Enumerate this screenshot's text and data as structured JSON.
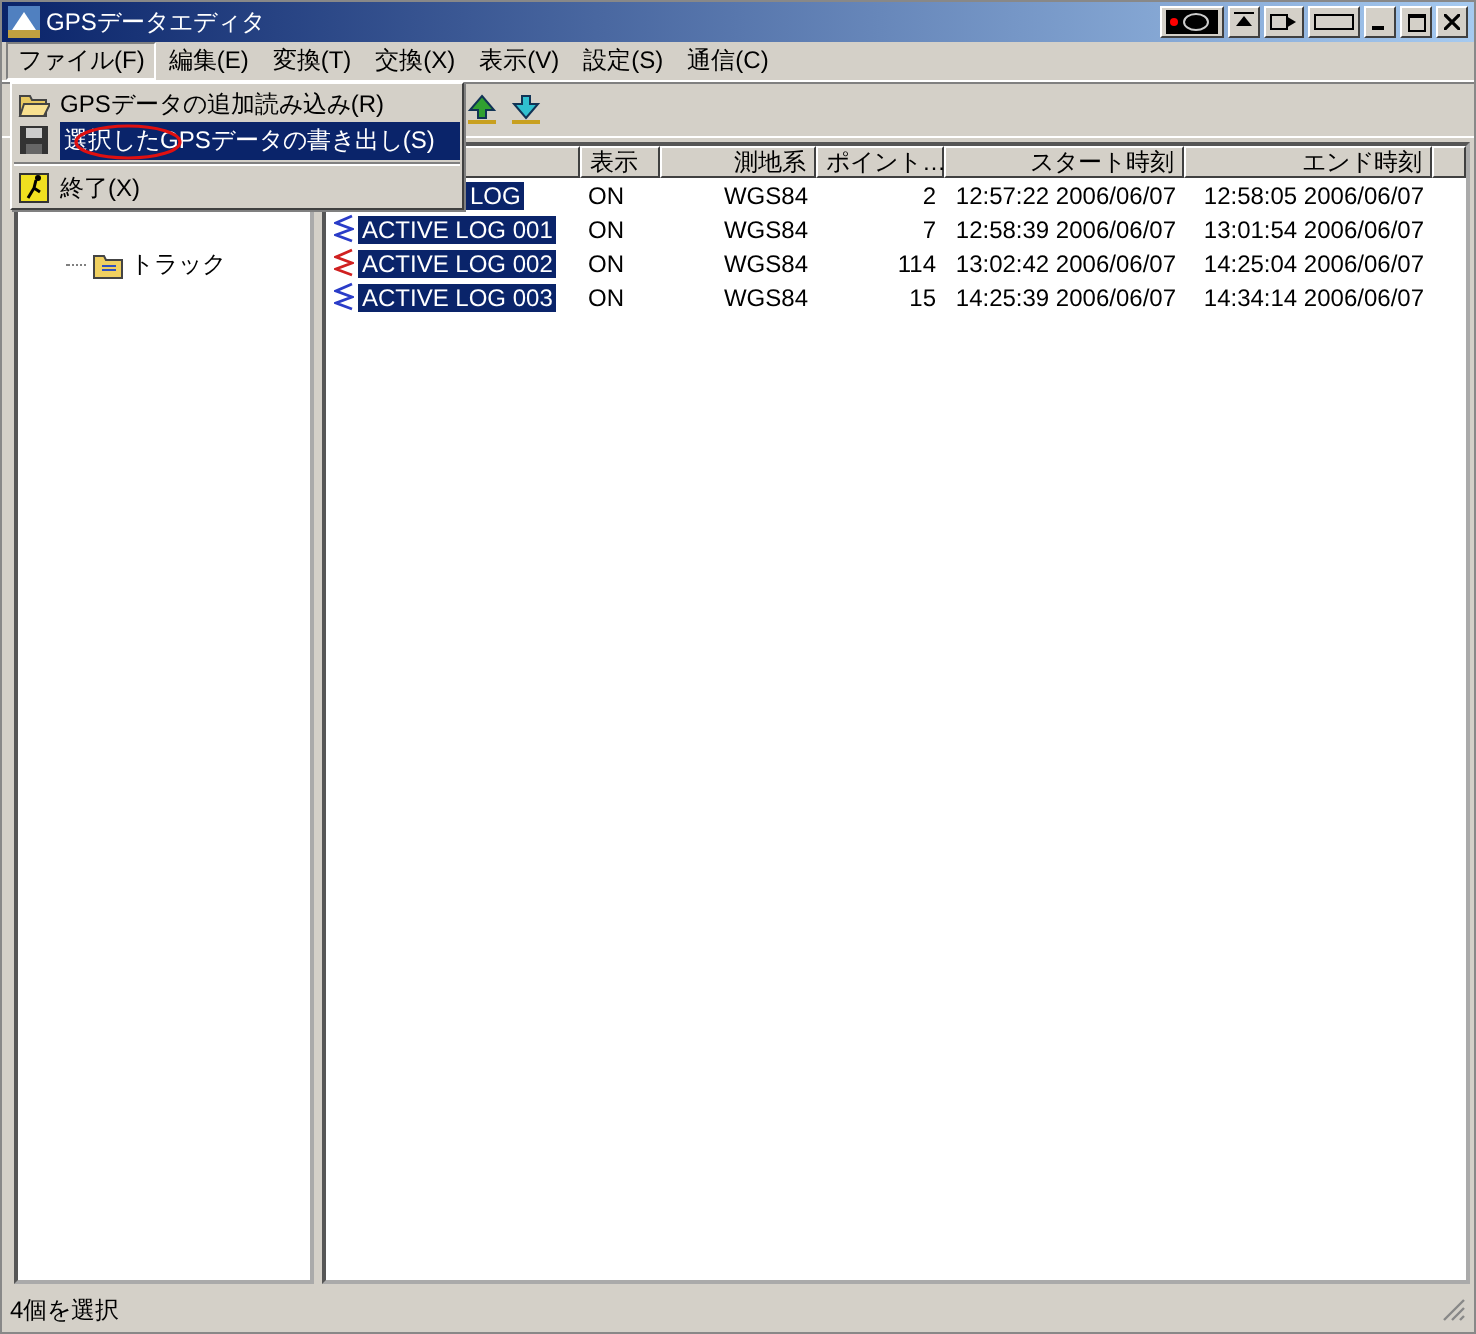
{
  "window": {
    "title": "GPSデータエディタ"
  },
  "menu_bar": [
    {
      "label": "ファイル(F)",
      "selected": true
    },
    {
      "label": "編集(E)",
      "selected": false
    },
    {
      "label": "変換(T)",
      "selected": false
    },
    {
      "label": "交換(X)",
      "selected": false
    },
    {
      "label": "表示(V)",
      "selected": false
    },
    {
      "label": "設定(S)",
      "selected": false
    },
    {
      "label": "通信(C)",
      "selected": false
    }
  ],
  "file_menu": [
    {
      "kind": "open",
      "label": "GPSデータの追加読み込み(R)",
      "selected": false,
      "separator_before": false
    },
    {
      "kind": "save",
      "label": "選択したGPSデータの書き出し(S)",
      "selected": true,
      "separator_before": false
    },
    {
      "kind": "exit",
      "label": "終了(X)",
      "selected": false,
      "separator_before": true
    }
  ],
  "tree": {
    "items": [
      {
        "label": "トラック"
      }
    ]
  },
  "table": {
    "columns": [
      "表示",
      "測地系",
      "ポイント…",
      "スタート時刻",
      "エンド時刻"
    ],
    "rows": [
      {
        "name": "LOG",
        "selected": true,
        "cells": [
          "ON",
          "WGS84",
          "2",
          "12:57:22 2006/06/07",
          "12:58:05 2006/06/07"
        ]
      },
      {
        "name": "ACTIVE LOG 001",
        "color": "#2a3cc8",
        "selected": true,
        "cells": [
          "ON",
          "WGS84",
          "7",
          "12:58:39 2006/06/07",
          "13:01:54 2006/06/07"
        ]
      },
      {
        "name": "ACTIVE LOG 002",
        "color": "#d02020",
        "selected": true,
        "cells": [
          "ON",
          "WGS84",
          "114",
          "13:02:42 2006/06/07",
          "14:25:04 2006/06/07"
        ]
      },
      {
        "name": "ACTIVE LOG 003",
        "color": "#2a3cc8",
        "selected": true,
        "cells": [
          "ON",
          "WGS84",
          "15",
          "14:25:39 2006/06/07",
          "14:34:14 2006/06/07"
        ]
      }
    ]
  },
  "status_bar": {
    "text": "4個を選択"
  }
}
